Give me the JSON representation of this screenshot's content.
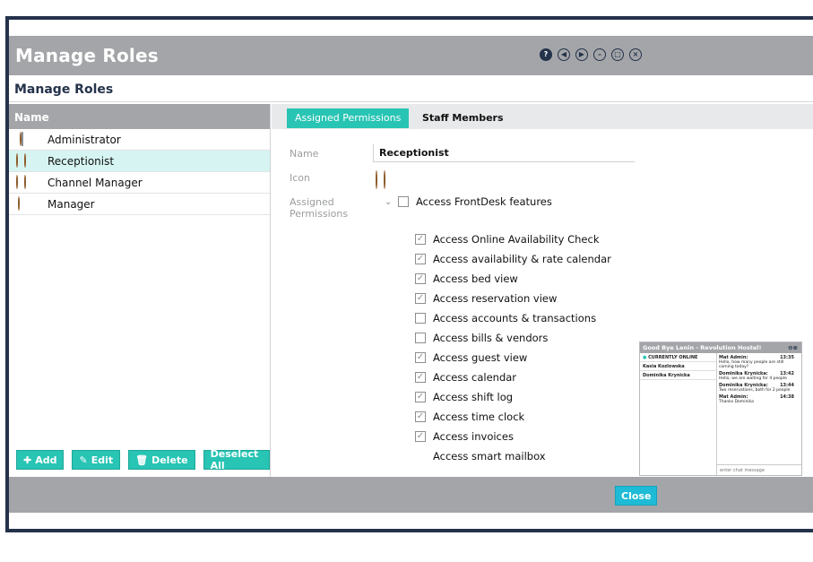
{
  "window": {
    "title": "Manage Roles",
    "subtitle": "Manage Roles"
  },
  "title_icons": [
    "help-icon",
    "prev-icon",
    "next-icon",
    "minimize-icon",
    "restore-icon",
    "close-icon"
  ],
  "roles_panel": {
    "column_header": "Name",
    "roles": [
      {
        "label": "Administrator",
        "icon": "single-user-icon"
      },
      {
        "label": "Receptionist",
        "icon": "two-users-icon",
        "selected": true
      },
      {
        "label": "Channel Manager",
        "icon": "two-users-icon"
      },
      {
        "label": "Manager",
        "icon": "user-tie-icon"
      }
    ],
    "buttons": {
      "add": "Add",
      "edit": "Edit",
      "delete": "Delete",
      "deselect_all": "Deselect All"
    }
  },
  "tabs": {
    "active": "Assigned Permissions",
    "other": "Staff Members"
  },
  "form": {
    "name_label": "Name",
    "name_value": "Receptionist",
    "icon_label": "Icon",
    "permissions_label": "Assigned Permissions",
    "group": {
      "label": "Access FrontDesk features",
      "checked": false
    },
    "permissions": [
      {
        "label": "Access Online Availability Check",
        "checked": true
      },
      {
        "label": "Access  availability & rate calendar",
        "checked": true
      },
      {
        "label": "Access bed view",
        "checked": true
      },
      {
        "label": "Access reservation view",
        "checked": true
      },
      {
        "label": "Access accounts & transactions",
        "checked": false
      },
      {
        "label": "Access bills & vendors",
        "checked": false
      },
      {
        "label": "Access guest view",
        "checked": true
      },
      {
        "label": "Access calendar",
        "checked": true
      },
      {
        "label": "Access shift log",
        "checked": true
      },
      {
        "label": "Access time clock",
        "checked": true
      },
      {
        "label": "Access invoices",
        "checked": true
      },
      {
        "label": "Access smart mailbox",
        "checked": null
      }
    ]
  },
  "chat": {
    "title": "Good Bye Lenin - Revolution Hostel!",
    "online_label": "CURRENTLY ONLINE",
    "users": [
      "Kasia Kozlowska",
      "Dominika Krynicka"
    ],
    "messages": [
      {
        "author": "Mat Admin:",
        "time": "13:35",
        "text": "Hello, how many people are still coming today?"
      },
      {
        "author": "Dominika Krynicka:",
        "time": "13:42",
        "text": "Hello, we are waiting for 4 people"
      },
      {
        "author": "Dominika Krynicka:",
        "time": "13:44",
        "text": "Two reservations, both for 2 people"
      },
      {
        "author": "Mat Admin:",
        "time": "14:38",
        "text": "Thanks Dominika"
      }
    ],
    "input_placeholder": "enter chat message"
  },
  "footer": {
    "close": "Close"
  },
  "colors": {
    "accent": "#28c4b4",
    "header_gray": "#a3a5a8",
    "navy": "#24324b",
    "close_blue": "#1ebbd6"
  }
}
